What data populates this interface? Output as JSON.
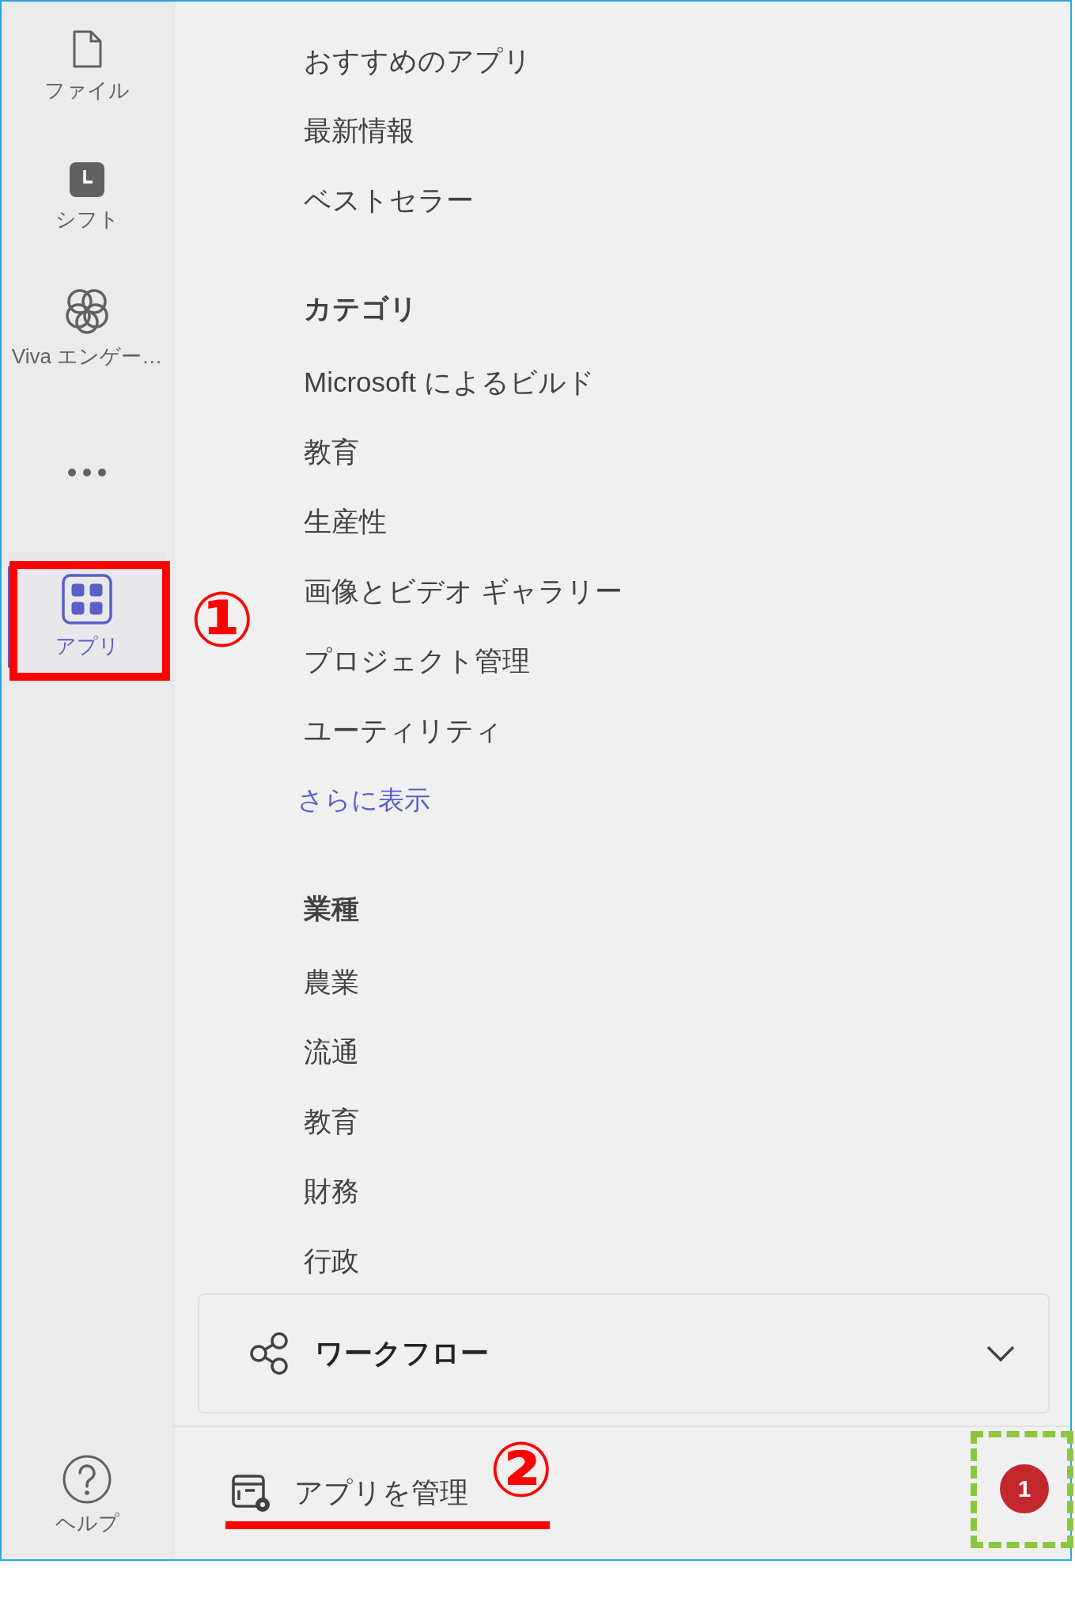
{
  "rail": {
    "items": [
      {
        "kind": "file",
        "label": "ファイル",
        "selected": false
      },
      {
        "kind": "shift",
        "label": "シフト",
        "selected": false
      },
      {
        "kind": "viva",
        "label": "Viva エンゲー…",
        "selected": false
      },
      {
        "kind": "more",
        "selected": false
      },
      {
        "kind": "apps",
        "label": "アプリ",
        "selected": true
      }
    ],
    "help": {
      "label": "ヘルプ"
    }
  },
  "store_nav": {
    "items": [
      {
        "kind": "item",
        "text": "おすすめのアプリ"
      },
      {
        "kind": "item",
        "text": "最新情報"
      },
      {
        "kind": "item",
        "text": "ベストセラー"
      },
      {
        "kind": "heading",
        "text": "カテゴリ"
      },
      {
        "kind": "item",
        "text": "Microsoft によるビルド"
      },
      {
        "kind": "item",
        "text": "教育"
      },
      {
        "kind": "item",
        "text": "生産性"
      },
      {
        "kind": "item",
        "text": "画像とビデオ ギャラリー"
      },
      {
        "kind": "item",
        "text": "プロジェクト管理"
      },
      {
        "kind": "item",
        "text": "ユーティリティ"
      },
      {
        "kind": "link",
        "text": "さらに表示"
      },
      {
        "kind": "heading",
        "text": "業種"
      },
      {
        "kind": "item",
        "text": "農業"
      },
      {
        "kind": "item",
        "text": "流通"
      },
      {
        "kind": "item",
        "text": "教育"
      },
      {
        "kind": "item",
        "text": "財務"
      },
      {
        "kind": "item",
        "text": "行政"
      }
    ]
  },
  "workflow": {
    "label": "ワークフロー",
    "expanded": false
  },
  "manage_apps": {
    "label": "アプリを管理"
  },
  "notification_badge": {
    "count": "1"
  },
  "annotations": {
    "markers": [
      "①",
      "②"
    ]
  }
}
